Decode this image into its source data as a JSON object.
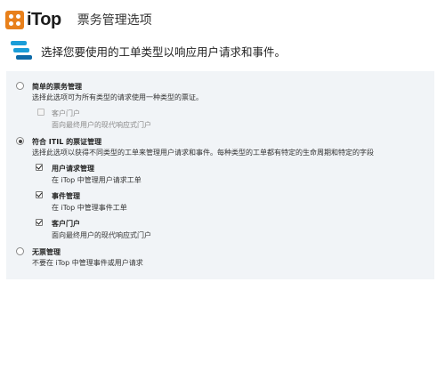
{
  "header": {
    "logo_text": "iTop",
    "title": "票务管理选项"
  },
  "subheader": {
    "text": "选择您要使用的工单类型以响应用户请求和事件。"
  },
  "options": {
    "simple": {
      "label": "简单的票务管理",
      "description": "选择此选项可为所有类型的请求使用一种类型的票证。",
      "selected": false,
      "portal": {
        "label": "客户门户",
        "description": "面向最终用户的现代响应式门户",
        "checked": false,
        "disabled": true
      }
    },
    "itil": {
      "label": "符合 ITIL 的票证管理",
      "description": "选择此选项以获得不同类型的工单来管理用户请求和事件。每种类型的工单都有特定的生命周期和特定的字段",
      "selected": true,
      "sub_options": [
        {
          "label": "用户请求管理",
          "description": "在 iTop 中管理用户请求工单",
          "checked": true
        },
        {
          "label": "事件管理",
          "description": "在 iTop 中管理事件工单",
          "checked": true
        },
        {
          "label": "客户门户",
          "description": "面向最终用户的现代响应式门户",
          "checked": true
        }
      ]
    },
    "none": {
      "label": "无票管理",
      "description": "不要在 iTop 中管理事件或用户请求",
      "selected": false
    }
  },
  "colors": {
    "logo_orange": "#e8801b",
    "icon_blue": "#1a9dd8",
    "panel_bg": "#f1f4f7"
  }
}
